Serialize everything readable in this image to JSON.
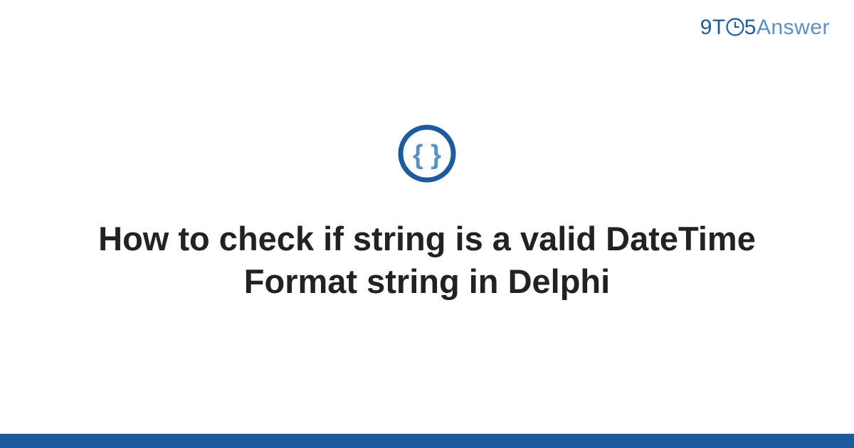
{
  "logo": {
    "part1": "9T",
    "part2": "5",
    "part3": "Answer"
  },
  "title": "How to check if string is a valid DateTime Format string in Delphi",
  "colors": {
    "brand_dark": "#1e5a9e",
    "brand_light": "#5b8fc7",
    "text": "#222222"
  }
}
